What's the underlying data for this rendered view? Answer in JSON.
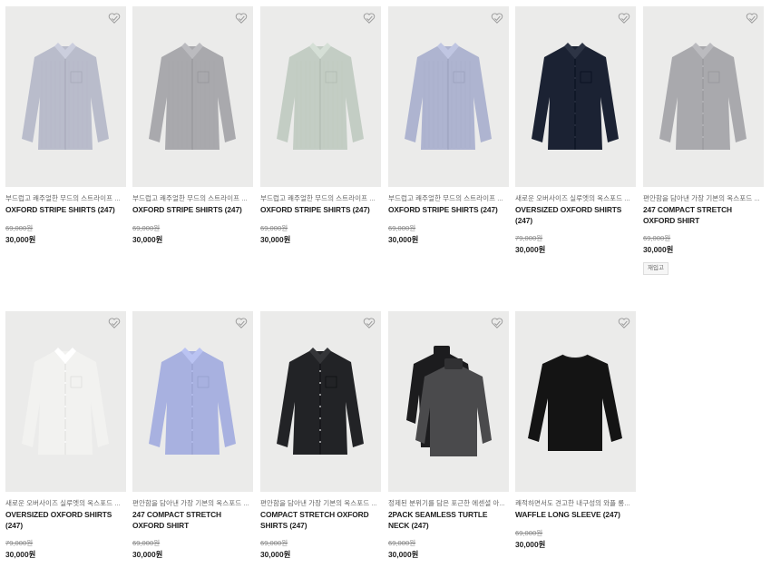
{
  "products": [
    {
      "desc": "부드럽고 쾌주얼한 무드의 스트라이프 ...",
      "name": "OXFORD STRIPE SHIRTS (247)",
      "original_price": "69,000원",
      "price": "30,000원",
      "garment_color": "#b9bccb",
      "style": "shirt-stripe"
    },
    {
      "desc": "부드럽고 쾌주얼한 무드의 스트라이프 ...",
      "name": "OXFORD STRIPE SHIRTS (247)",
      "original_price": "69,000원",
      "price": "30,000원",
      "garment_color": "#a9a9ad",
      "style": "shirt-stripe"
    },
    {
      "desc": "부드럽고 쾌주얼한 무드의 스트라이프 ...",
      "name": "OXFORD STRIPE SHIRTS (247)",
      "original_price": "69,000원",
      "price": "30,000원",
      "garment_color": "#c3cdc4",
      "style": "shirt-stripe"
    },
    {
      "desc": "부드럽고 쾌주얼한 무드의 스트라이프 ...",
      "name": "OXFORD STRIPE SHIRTS (247)",
      "original_price": "69,000원",
      "price": "30,000원",
      "garment_color": "#aeb4d0",
      "style": "shirt-stripe"
    },
    {
      "desc": "새로운 오버사이즈 실루엣의 옥스포드 ...",
      "name": "OVERSIZED OXFORD SHIRTS (247)",
      "original_price": "79,000원",
      "price": "30,000원",
      "garment_color": "#1b2233",
      "style": "shirt"
    },
    {
      "desc": "편안함을 담아낸 가장 기본의 옥스포드 ...",
      "name": "247 COMPACT STRETCH OXFORD SHIRT",
      "original_price": "69,000원",
      "price": "30,000원",
      "garment_color": "#a9a9ad",
      "style": "shirt",
      "tag": "재입고"
    },
    {
      "desc": "새로운 오버사이즈 실루엣의 옥스포드 ...",
      "name": "OVERSIZED OXFORD SHIRTS (247)",
      "original_price": "79,000원",
      "price": "30,000원",
      "garment_color": "#f2f2f0",
      "style": "shirt"
    },
    {
      "desc": "편안함을 담아낸 가장 기본의 옥스포드 ...",
      "name": "247 COMPACT STRETCH OXFORD SHIRT",
      "original_price": "69,000원",
      "price": "30,000원",
      "garment_color": "#a8b1e0",
      "style": "shirt"
    },
    {
      "desc": "편안함을 담아낸 가장 기본의 옥스포드 ...",
      "name": "COMPACT STRETCH OXFORD SHIRTS (247)",
      "original_price": "69,000원",
      "price": "30,000원",
      "garment_color": "#222326",
      "style": "shirt-buttons"
    },
    {
      "desc": "정제된 분위기를 담은 포근한 에센셜 아...",
      "name": "2PACK SEAMLESS TURTLE NECK (247)",
      "original_price": "69,000원",
      "price": "30,000원",
      "garment_color": "#4a4a4c",
      "style": "turtleneck"
    },
    {
      "desc": "쾌적하면서도 견고한 내구성의 와플 롱...",
      "name": "WAFFLE LONG SLEEVE (247)",
      "original_price": "69,000원",
      "price": "30,000원",
      "garment_color": "#141414",
      "style": "longsleeve"
    }
  ],
  "icons": {
    "wishlist": "heart-outline-icon"
  }
}
